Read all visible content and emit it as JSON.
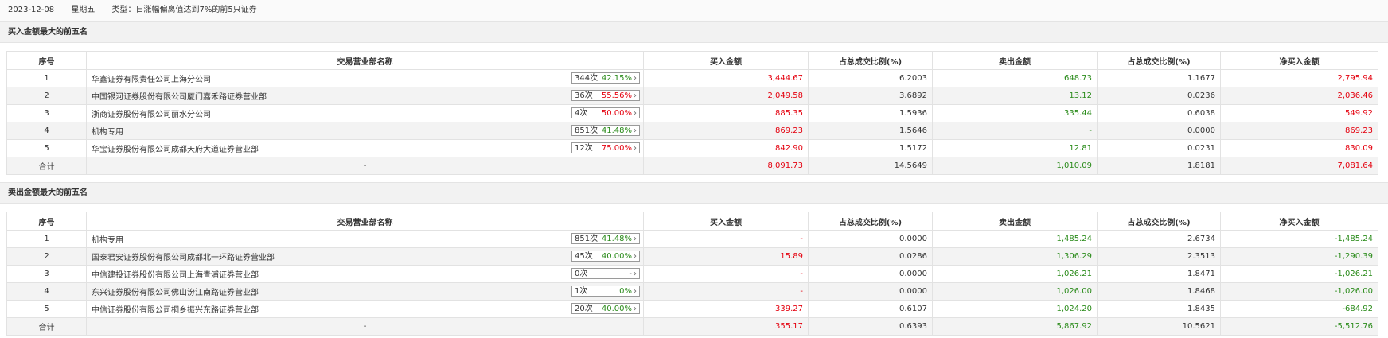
{
  "header": {
    "date": "2023-12-08",
    "weekday": "星期五",
    "type": "类型：日涨幅偏离值达到7%的前5只证券"
  },
  "buy_section": {
    "title": "买入金额最大的前五名",
    "columns": [
      "序号",
      "交易营业部名称",
      "买入金额",
      "占总成交比例(%)",
      "卖出金额",
      "占总成交比例(%)",
      "净买入金额"
    ],
    "rows": [
      {
        "no": "1",
        "name": "华鑫证券有限责任公司上海分公司",
        "count": "344次",
        "pct": "42.15%",
        "pct_color": "green",
        "buy": "3,444.67",
        "buy_ratio": "6.2003",
        "sell": "648.73",
        "sell_ratio": "1.1677",
        "net": "2,795.94"
      },
      {
        "no": "2",
        "name": "中国银河证券股份有限公司厦门嘉禾路证券营业部",
        "count": "36次",
        "pct": "55.56%",
        "pct_color": "red",
        "buy": "2,049.58",
        "buy_ratio": "3.6892",
        "sell": "13.12",
        "sell_ratio": "0.0236",
        "net": "2,036.46"
      },
      {
        "no": "3",
        "name": "浙商证券股份有限公司丽水分公司",
        "count": "4次",
        "pct": "50.00%",
        "pct_color": "red",
        "buy": "885.35",
        "buy_ratio": "1.5936",
        "sell": "335.44",
        "sell_ratio": "0.6038",
        "net": "549.92"
      },
      {
        "no": "4",
        "name": "机构专用",
        "count": "851次",
        "pct": "41.48%",
        "pct_color": "green",
        "buy": "869.23",
        "buy_ratio": "1.5646",
        "sell": "-",
        "sell_ratio": "0.0000",
        "net": "869.23"
      },
      {
        "no": "5",
        "name": "华宝证券股份有限公司成都天府大道证券营业部",
        "count": "12次",
        "pct": "75.00%",
        "pct_color": "red",
        "buy": "842.90",
        "buy_ratio": "1.5172",
        "sell": "12.81",
        "sell_ratio": "0.0231",
        "net": "830.09"
      }
    ],
    "total": {
      "label": "合计",
      "name": "-",
      "buy": "8,091.73",
      "buy_ratio": "14.5649",
      "sell": "1,010.09",
      "sell_ratio": "1.8181",
      "net": "7,081.64"
    }
  },
  "sell_section": {
    "title": "卖出金额最大的前五名",
    "columns": [
      "序号",
      "交易营业部名称",
      "买入金额",
      "占总成交比例(%)",
      "卖出金额",
      "占总成交比例(%)",
      "净买入金额"
    ],
    "rows": [
      {
        "no": "1",
        "name": "机构专用",
        "count": "851次",
        "pct": "41.48%",
        "pct_color": "green",
        "buy": "-",
        "buy_ratio": "0.0000",
        "sell": "1,485.24",
        "sell_ratio": "2.6734",
        "net": "-1,485.24"
      },
      {
        "no": "2",
        "name": "国泰君安证券股份有限公司成都北一环路证券营业部",
        "count": "45次",
        "pct": "40.00%",
        "pct_color": "green",
        "buy": "15.89",
        "buy_ratio": "0.0286",
        "sell": "1,306.29",
        "sell_ratio": "2.3513",
        "net": "-1,290.39"
      },
      {
        "no": "3",
        "name": "中信建投证券股份有限公司上海青浦证券营业部",
        "count": "0次",
        "pct": "-",
        "pct_color": "dark",
        "buy": "-",
        "buy_ratio": "0.0000",
        "sell": "1,026.21",
        "sell_ratio": "1.8471",
        "net": "-1,026.21"
      },
      {
        "no": "4",
        "name": "东兴证券股份有限公司佛山汾江南路证券营业部",
        "count": "1次",
        "pct": "0%",
        "pct_color": "green",
        "buy": "-",
        "buy_ratio": "0.0000",
        "sell": "1,026.00",
        "sell_ratio": "1.8468",
        "net": "-1,026.00"
      },
      {
        "no": "5",
        "name": "中信证券股份有限公司桐乡振兴东路证券营业部",
        "count": "20次",
        "pct": "40.00%",
        "pct_color": "green",
        "buy": "339.27",
        "buy_ratio": "0.6107",
        "sell": "1,024.20",
        "sell_ratio": "1.8435",
        "net": "-684.92"
      }
    ],
    "total": {
      "label": "合计",
      "name": "-",
      "buy": "355.17",
      "buy_ratio": "0.6393",
      "sell": "5,867.92",
      "sell_ratio": "10.5621",
      "net": "-5,512.76"
    }
  },
  "colors": {
    "red": "#e4000e",
    "green": "#2a8b1a",
    "dark": "#333333"
  }
}
